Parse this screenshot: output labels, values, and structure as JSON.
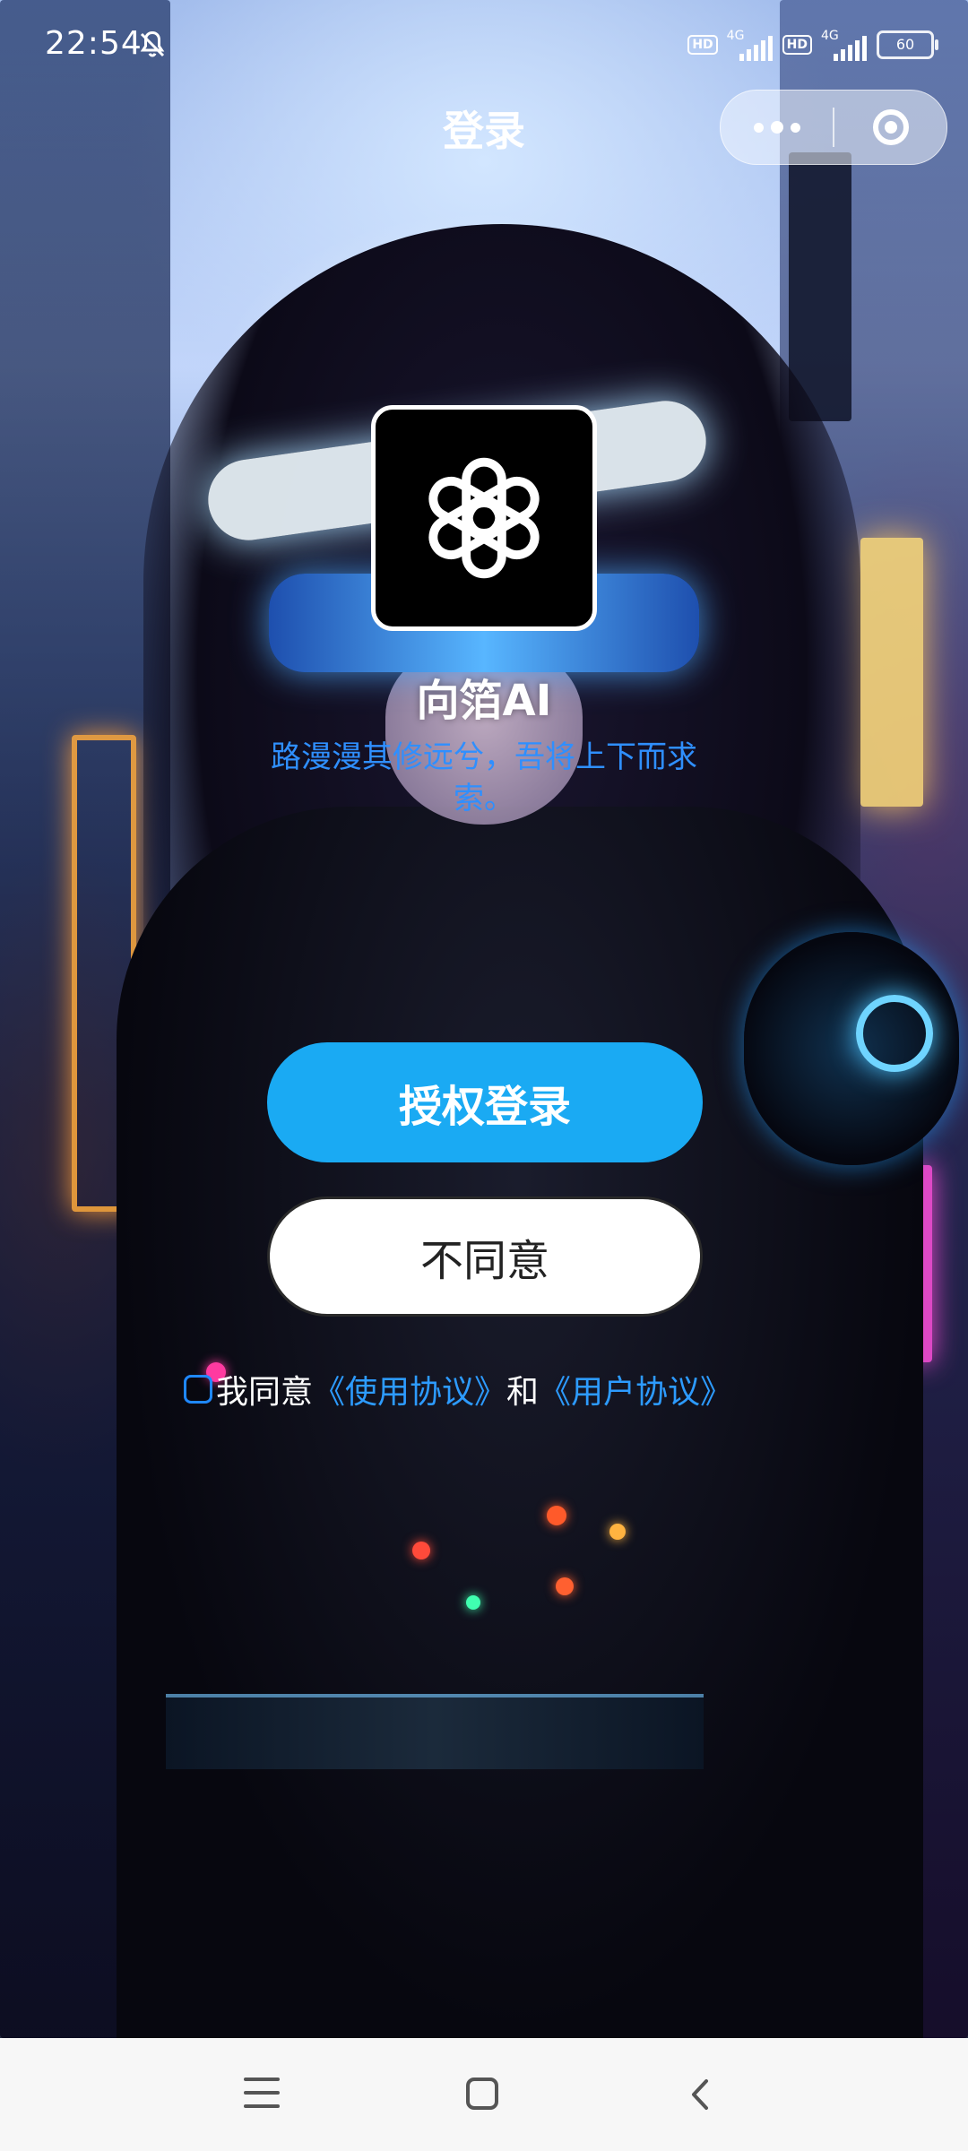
{
  "status_bar": {
    "time": "22:54",
    "notification_icon": "bell-muted-icon",
    "sim1": {
      "hd": "HD",
      "network": "4G"
    },
    "sim2": {
      "hd": "HD",
      "network": "4G"
    },
    "battery": "60"
  },
  "nav": {
    "title": "登录",
    "more_icon": "more-dots-icon",
    "close_icon": "target-close-icon"
  },
  "app": {
    "logo_icon": "openai-knot-icon",
    "name": "向箔AI",
    "slogan": "路漫漫其修远兮，吾将上下而求索。"
  },
  "buttons": {
    "authorize_label": "授权登录",
    "decline_label": "不同意"
  },
  "agreement": {
    "prefix": "我同意",
    "terms_link": "《使用协议》",
    "conjunction": "和",
    "user_link": "《用户协议》",
    "checked": false
  },
  "system_nav": {
    "menu_icon": "menu-icon",
    "home_icon": "home-icon",
    "back_icon": "back-icon"
  },
  "colors": {
    "accent": "#1aaaf3",
    "link": "#2d9bff",
    "slogan": "#2f8fff"
  }
}
